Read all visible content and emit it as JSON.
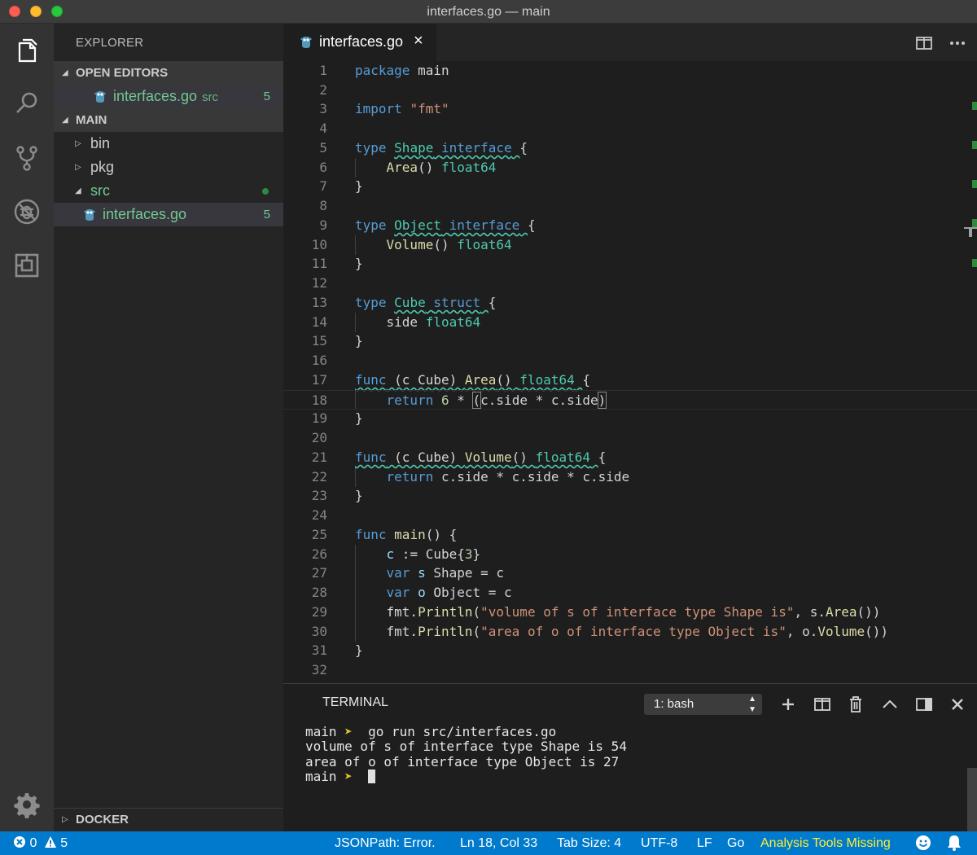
{
  "window": {
    "title": "interfaces.go — main"
  },
  "sidebar": {
    "title": "EXPLORER",
    "open_editors": {
      "header": "OPEN EDITORS",
      "items": [
        {
          "name": "interfaces.go",
          "desc": "src",
          "count": "5"
        }
      ]
    },
    "folder": {
      "header": "MAIN",
      "items": [
        {
          "name": "bin"
        },
        {
          "name": "pkg"
        },
        {
          "name": "src"
        },
        {
          "name": "interfaces.go",
          "count": "5"
        }
      ]
    },
    "docker": {
      "header": "DOCKER"
    }
  },
  "editor": {
    "tab": {
      "name": "interfaces.go",
      "close": "×"
    },
    "lines": [
      "package main",
      "",
      "import \"fmt\"",
      "",
      "type Shape interface {",
      "    Area() float64",
      "}",
      "",
      "type Object interface {",
      "    Volume() float64",
      "}",
      "",
      "type Cube struct {",
      "    side float64",
      "}",
      "",
      "func (c Cube) Area() float64 {",
      "    return 6 * (c.side * c.side)",
      "}",
      "",
      "func (c Cube) Volume() float64 {",
      "    return c.side * c.side * c.side",
      "}",
      "",
      "func main() {",
      "    c := Cube{3}",
      "    var s Shape = c",
      "    var o Object = c",
      "    fmt.Println(\"volume of s of interface type Shape is\", s.Area())",
      "    fmt.Println(\"area of o of interface type Object is\", o.Volume())",
      "}",
      ""
    ],
    "current_line": 18
  },
  "panel": {
    "title": "TERMINAL",
    "terminal_select": "1: bash",
    "output": [
      {
        "prompt": "main",
        "arrow": "➤",
        "command": "go run src/interfaces.go"
      },
      {
        "text": "volume of s of interface type Shape is 54"
      },
      {
        "text": "area of o of interface type Object is 27"
      },
      {
        "prompt": "main",
        "arrow": "➤",
        "command": ""
      }
    ]
  },
  "statusbar": {
    "errors": "0",
    "warnings": "5",
    "jsonpath": "JSONPath: Error.",
    "position": "Ln 18, Col 33",
    "tab_size": "Tab Size: 4",
    "encoding": "UTF-8",
    "eol": "LF",
    "language": "Go",
    "analysis": "Analysis Tools Missing"
  },
  "colors": {
    "accent": "#007acc",
    "keyword": "#569cd6",
    "type": "#4ec9b0",
    "function": "#dcdcaa",
    "string": "#ce9178",
    "git_modified": "#73c991",
    "warning_text": "#ffee33"
  }
}
